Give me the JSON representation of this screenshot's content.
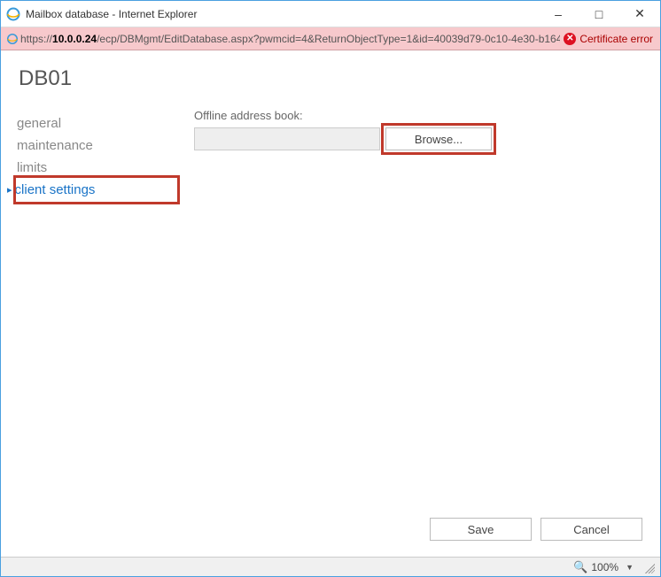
{
  "window": {
    "title": "Mailbox database - Internet Explorer"
  },
  "address": {
    "scheme": "https://",
    "host": "10.0.0.24",
    "path": "/ecp/DBMgmt/EditDatabase.aspx?pwmcid=4&ReturnObjectType=1&id=40039d79-0c10-4e30-b164",
    "cert_error_label": "Certificate error"
  },
  "page": {
    "title": "DB01"
  },
  "sidebar": {
    "items": [
      {
        "label": "general",
        "selected": false
      },
      {
        "label": "maintenance",
        "selected": false
      },
      {
        "label": "limits",
        "selected": false
      },
      {
        "label": "client settings",
        "selected": true
      }
    ]
  },
  "form": {
    "offline_address_book_label": "Offline address book:",
    "offline_address_book_value": "",
    "browse_label": "Browse..."
  },
  "footer": {
    "save_label": "Save",
    "cancel_label": "Cancel"
  },
  "status": {
    "zoom_label": "100%"
  }
}
